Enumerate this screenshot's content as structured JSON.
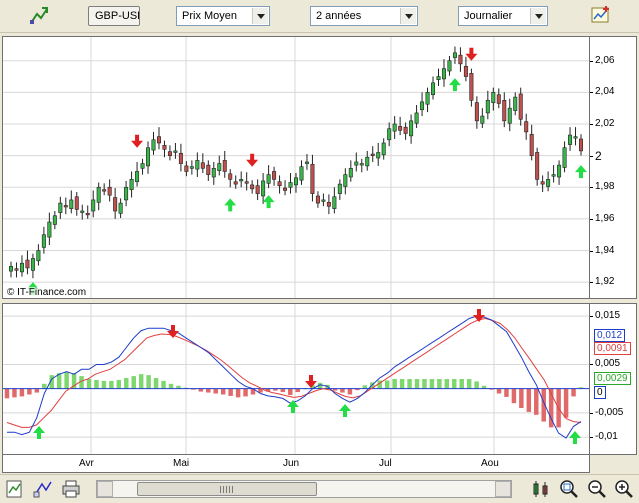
{
  "toolbar": {
    "symbol": "GBP-USD",
    "indicator_select": "Prix Moyen",
    "period_select": "2 années",
    "interval_select": "Journalier"
  },
  "watermark": "© IT-Finance.com",
  "price_axis_labels": [
    "2,06",
    "2,04",
    "2,02",
    "2",
    "1,98",
    "1,96",
    "1,94",
    "1,92"
  ],
  "macd_axis_labels": [
    "0,015",
    "0,005",
    "-0,005",
    "-0,01"
  ],
  "macd_tags": {
    "blue": "0,012",
    "red": "0,0091",
    "green": "0,0029",
    "zero": "0"
  },
  "x_axis_labels": [
    "Avr",
    "Mai",
    "Jun",
    "Jul",
    "Aou"
  ],
  "colors": {
    "bull": "#39b54a",
    "bear": "#c0504d",
    "macd_line": "#1f3cc8",
    "signal_line": "#e04040",
    "hist_pos": "#7fd66f",
    "hist_neg": "#e06a6a",
    "arrow_up": "#22dd44",
    "arrow_down": "#e02020",
    "grid": "#d8d8d8"
  },
  "chart_data": [
    {
      "type": "candlestick",
      "title": "",
      "ylim": [
        1.91,
        2.075
      ],
      "close_series": [
        1.93,
        1.928,
        1.932,
        1.929,
        1.935,
        1.94,
        1.95,
        1.958,
        1.962,
        1.97,
        1.968,
        1.972,
        1.966,
        1.965,
        1.963,
        1.972,
        1.98,
        1.978,
        1.975,
        1.965,
        1.97,
        1.98,
        1.985,
        1.99,
        1.995,
        2.005,
        2.01,
        2.008,
        2.004,
        2.0,
        2.003,
        1.995,
        1.99,
        1.993,
        1.997,
        1.992,
        1.988,
        1.992,
        1.995,
        1.99,
        1.985,
        1.982,
        1.985,
        1.983,
        1.979,
        1.976,
        1.984,
        1.988,
        1.985,
        1.981,
        1.978,
        1.983,
        1.986,
        1.993,
        1.996,
        1.976,
        1.97,
        1.972,
        1.968,
        1.974,
        1.982,
        1.988,
        1.992,
        1.996,
        1.995,
        1.999,
        2.0,
        2.002,
        2.008,
        2.017,
        2.02,
        2.016,
        2.014,
        2.022,
        2.027,
        2.034,
        2.04,
        2.046,
        2.05,
        2.055,
        2.06,
        2.065,
        2.058,
        2.05,
        2.035,
        2.022,
        2.025,
        2.035,
        2.04,
        2.033,
        2.022,
        2.03,
        2.037,
        2.023,
        2.015,
        2.0,
        1.985,
        1.982,
        1.985,
        1.988,
        1.994,
        2.005,
        2.013,
        2.012,
        2.003
      ],
      "up_arrows_at": [
        4,
        40,
        47,
        81,
        104
      ],
      "down_arrows_at": [
        23,
        44,
        84
      ]
    },
    {
      "type": "line",
      "title": "",
      "ylim": [
        -0.0135,
        0.0175
      ],
      "series": [
        {
          "values": [
            -0.009,
            -0.009,
            -0.0095,
            -0.009,
            -0.006,
            -0.001,
            0.002,
            0.003,
            0.0035,
            0.003,
            0.004,
            0.004,
            0.005,
            0.005,
            0.0055,
            0.0065,
            0.0085,
            0.0105,
            0.012,
            0.0125,
            0.0125,
            0.0125,
            0.012,
            0.0115,
            0.0105,
            0.0095,
            0.0085,
            0.0075,
            0.006,
            0.0045,
            0.003,
            0.0015,
            0.0005,
            0.0,
            -0.001,
            -0.0015,
            -0.0017,
            -0.002,
            -0.003,
            -0.0025,
            -0.0015,
            0.0,
            0.0008,
            0.0005,
            -0.001,
            -0.002,
            -0.0028,
            -0.002,
            -0.0008,
            0.0008,
            0.0022,
            0.0032,
            0.0045,
            0.0055,
            0.0065,
            0.0075,
            0.0085,
            0.0095,
            0.0105,
            0.0115,
            0.0125,
            0.0135,
            0.0145,
            0.015,
            0.0148,
            0.0142,
            0.013,
            0.0118,
            0.0092,
            0.0065,
            0.0035,
            0.0008,
            -0.0028,
            -0.0062,
            -0.0092,
            -0.0102,
            -0.0078,
            -0.0068
          ]
        },
        {
          "values": [
            -0.007,
            -0.0075,
            -0.008,
            -0.008,
            -0.0075,
            -0.006,
            -0.0045,
            -0.0025,
            -0.0005,
            0.0005,
            0.0015,
            0.002,
            0.003,
            0.0035,
            0.004,
            0.005,
            0.006,
            0.0075,
            0.009,
            0.0105,
            0.011,
            0.0113,
            0.0112,
            0.0108,
            0.0102,
            0.0095,
            0.0088,
            0.008,
            0.007,
            0.006,
            0.0048,
            0.0035,
            0.0022,
            0.0012,
            0.0005,
            -0.0003,
            -0.0008,
            -0.0011,
            -0.0015,
            -0.0018,
            -0.0016,
            -0.001,
            -0.0004,
            0.0,
            -0.0003,
            -0.001,
            -0.0016,
            -0.0019,
            -0.0015,
            -0.0005,
            0.0005,
            0.0015,
            0.0025,
            0.0035,
            0.0045,
            0.0055,
            0.0065,
            0.0075,
            0.0085,
            0.0095,
            0.0105,
            0.0115,
            0.0125,
            0.0135,
            0.0142,
            0.0145,
            0.0141,
            0.0135,
            0.0122,
            0.0105,
            0.0083,
            0.0062,
            0.004,
            0.0018,
            -0.0012,
            -0.0042,
            -0.0062,
            -0.0068,
            -0.007
          ]
        },
        {
          "values": [
            -0.002,
            -0.0018,
            -0.0016,
            -0.0012,
            -0.0008,
            0.001,
            0.0028,
            0.0032,
            0.0035,
            0.0032,
            0.0026,
            0.002,
            0.0018,
            0.0016,
            0.0016,
            0.0018,
            0.0022,
            0.0026,
            0.003,
            0.0028,
            0.0022,
            0.0016,
            0.001,
            0.0006,
            0.0002,
            -0.0002,
            -0.0006,
            -0.0008,
            -0.001,
            -0.0012,
            -0.0015,
            -0.0018,
            -0.0016,
            -0.0012,
            -0.0008,
            -0.0006,
            -0.0004,
            -0.0007,
            -0.0013,
            -0.0007,
            0.0001,
            0.0007,
            0.0012,
            0.0008,
            -0.0004,
            -0.0008,
            -0.0012,
            -0.0003,
            0.0007,
            0.0013,
            0.0017,
            0.0017,
            0.002,
            0.002,
            0.002,
            0.002,
            0.002,
            0.002,
            0.002,
            0.002,
            0.002,
            0.002,
            0.002,
            0.0015,
            0.0006,
            -0.0002,
            -0.001,
            -0.0017,
            -0.003,
            -0.004,
            -0.0048,
            -0.0054,
            -0.0068,
            -0.008,
            -0.008,
            -0.006,
            -0.0016,
            0.0003
          ]
        }
      ]
    }
  ]
}
